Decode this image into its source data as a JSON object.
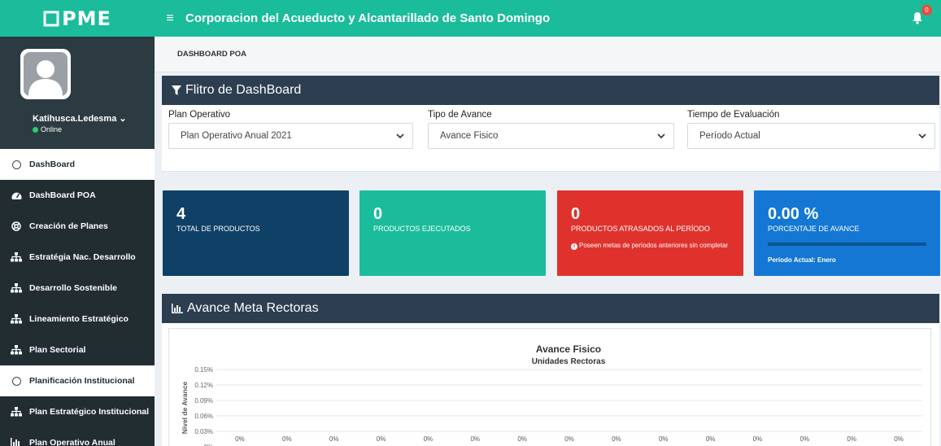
{
  "brand": {
    "logo": "PME"
  },
  "header": {
    "menu_icon": "hamburger-icon",
    "title": "Corporacion del Acueducto y Alcantarillado de Santo Domingo",
    "notification_count": "0"
  },
  "user": {
    "name": "Katihusca.Ledesma",
    "status": "Online"
  },
  "sidebar": {
    "items": [
      {
        "label": "DashBoard",
        "icon": "circle-icon",
        "style": "light"
      },
      {
        "label": "DashBoard POA",
        "icon": "dashboard-icon",
        "style": "dark"
      },
      {
        "label": "Creación de Planes",
        "icon": "life-ring-icon",
        "style": "dark"
      },
      {
        "label": "Estratégia Nac. Desarrollo",
        "icon": "sitemap-icon",
        "style": "dark"
      },
      {
        "label": "Desarrollo Sostenible",
        "icon": "sitemap-icon",
        "style": "dark"
      },
      {
        "label": "Lineamiento Estratégico",
        "icon": "sitemap-icon",
        "style": "dark"
      },
      {
        "label": "Plan Sectorial",
        "icon": "sitemap-icon",
        "style": "dark"
      },
      {
        "label": "Planificación Institucional",
        "icon": "circle-icon",
        "style": "light"
      },
      {
        "label": "Plan Estratégico Institucional",
        "icon": "sitemap-icon",
        "style": "dark"
      },
      {
        "label": "Plan Operativo Anual",
        "icon": "bar-chart-icon",
        "style": "dark"
      }
    ]
  },
  "breadcrumb": "DASHBOARD POA",
  "filter": {
    "title": "Flitro de DashBoard",
    "fields": [
      {
        "label": "Plan Operativo",
        "value": "Plan Operativo Anual 2021"
      },
      {
        "label": "Tipo de Avance",
        "value": "Avance Fisico"
      },
      {
        "label": "Tiempo de Evaluación",
        "value": "Período Actual"
      }
    ]
  },
  "cards": [
    {
      "value": "4",
      "label": "TOTAL DE PRODUCTOS",
      "color": "#0f4066"
    },
    {
      "value": "0",
      "label": "PRODUCTOS EJECUTADOS",
      "color": "#1bbc9b"
    },
    {
      "value": "0",
      "label": "PRODUCTOS ATRASADOS AL PERÍODO",
      "note": "Poseen metas de períodos anteriores sin completar",
      "color": "#e0322d"
    },
    {
      "value": "0.00 %",
      "label": "PORCENTAJE DE AVANCE",
      "progress": 0,
      "sub": "Período Actual: Enero",
      "color": "#1477d4"
    }
  ],
  "chart_panel": {
    "title": "Avance Meta Rectoras"
  },
  "chart_data": {
    "type": "bar",
    "title": "Avance Fisico",
    "subtitle": "Unidades Rectoras",
    "ylabel": "Nivel de Avance",
    "ytick_labels": [
      "0.15%",
      "0.12%",
      "0.09%",
      "0.06%",
      "0.03%",
      "0%"
    ],
    "ylim": [
      0,
      0.15
    ],
    "data_labels": [
      "0%",
      "0%",
      "0%",
      "0%",
      "0%",
      "0%",
      "0%",
      "0%",
      "0%",
      "0%",
      "0%",
      "0%",
      "0%",
      "0%",
      "0%"
    ],
    "values": [
      0,
      0,
      0,
      0,
      0,
      0,
      0,
      0,
      0,
      0,
      0,
      0,
      0,
      0,
      0
    ],
    "grid": true,
    "color": "#7cb5ec"
  }
}
